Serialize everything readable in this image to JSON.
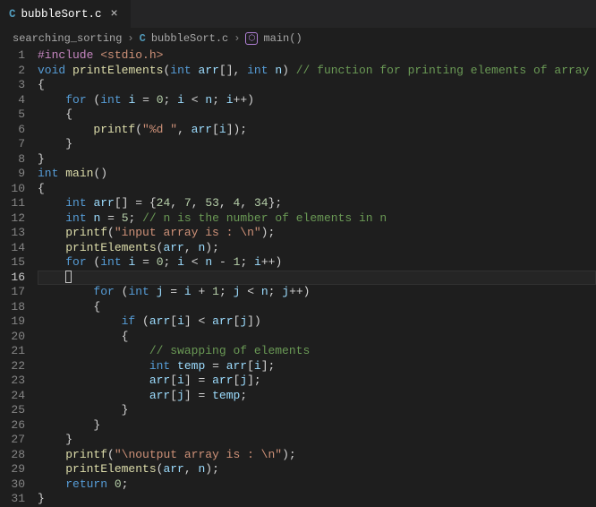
{
  "tab": {
    "icon_letter": "C",
    "filename": "bubbleSort.c",
    "close_glyph": "×"
  },
  "breadcrumb": {
    "folder": "searching_sorting",
    "chev": "›",
    "file_icon": "C",
    "filename": "bubbleSort.c",
    "symbol_icon": "⬡",
    "symbol": "main()"
  },
  "current_line": 16,
  "lines": [
    {
      "n": 1,
      "tokens": [
        [
          "pp",
          "#include"
        ],
        [
          "punc",
          " "
        ],
        [
          "inc",
          "<stdio.h>"
        ]
      ]
    },
    {
      "n": 2,
      "tokens": [
        [
          "type",
          "void"
        ],
        [
          "punc",
          " "
        ],
        [
          "fn",
          "printElements"
        ],
        [
          "punc",
          "("
        ],
        [
          "type",
          "int"
        ],
        [
          "punc",
          " "
        ],
        [
          "param",
          "arr"
        ],
        [
          "punc",
          "[], "
        ],
        [
          "type",
          "int"
        ],
        [
          "punc",
          " "
        ],
        [
          "param",
          "n"
        ],
        [
          "punc",
          ") "
        ],
        [
          "cmt",
          "// function for printing elements of array"
        ]
      ]
    },
    {
      "n": 3,
      "tokens": [
        [
          "punc",
          "{"
        ]
      ]
    },
    {
      "n": 4,
      "tokens": [
        [
          "punc",
          "    "
        ],
        [
          "kw",
          "for"
        ],
        [
          "punc",
          " ("
        ],
        [
          "type",
          "int"
        ],
        [
          "punc",
          " "
        ],
        [
          "var",
          "i"
        ],
        [
          "punc",
          " "
        ],
        [
          "op",
          "="
        ],
        [
          "punc",
          " "
        ],
        [
          "num",
          "0"
        ],
        [
          "punc",
          "; "
        ],
        [
          "var",
          "i"
        ],
        [
          "punc",
          " "
        ],
        [
          "op",
          "<"
        ],
        [
          "punc",
          " "
        ],
        [
          "var",
          "n"
        ],
        [
          "punc",
          "; "
        ],
        [
          "var",
          "i"
        ],
        [
          "op",
          "++"
        ],
        [
          "punc",
          ")"
        ]
      ]
    },
    {
      "n": 5,
      "tokens": [
        [
          "punc",
          "    {"
        ]
      ]
    },
    {
      "n": 6,
      "tokens": [
        [
          "punc",
          "        "
        ],
        [
          "fn",
          "printf"
        ],
        [
          "punc",
          "("
        ],
        [
          "str",
          "\"%d \""
        ],
        [
          "punc",
          ", "
        ],
        [
          "var",
          "arr"
        ],
        [
          "punc",
          "["
        ],
        [
          "var",
          "i"
        ],
        [
          "punc",
          "]);"
        ]
      ]
    },
    {
      "n": 7,
      "tokens": [
        [
          "punc",
          "    }"
        ]
      ]
    },
    {
      "n": 8,
      "tokens": [
        [
          "punc",
          "}"
        ]
      ]
    },
    {
      "n": 9,
      "tokens": [
        [
          "type",
          "int"
        ],
        [
          "punc",
          " "
        ],
        [
          "fn",
          "main"
        ],
        [
          "punc",
          "()"
        ]
      ]
    },
    {
      "n": 10,
      "tokens": [
        [
          "punc",
          "{"
        ]
      ]
    },
    {
      "n": 11,
      "tokens": [
        [
          "punc",
          "    "
        ],
        [
          "type",
          "int"
        ],
        [
          "punc",
          " "
        ],
        [
          "var",
          "arr"
        ],
        [
          "punc",
          "[] "
        ],
        [
          "op",
          "="
        ],
        [
          "punc",
          " {"
        ],
        [
          "num",
          "24"
        ],
        [
          "punc",
          ", "
        ],
        [
          "num",
          "7"
        ],
        [
          "punc",
          ", "
        ],
        [
          "num",
          "53"
        ],
        [
          "punc",
          ", "
        ],
        [
          "num",
          "4"
        ],
        [
          "punc",
          ", "
        ],
        [
          "num",
          "34"
        ],
        [
          "punc",
          "};"
        ]
      ]
    },
    {
      "n": 12,
      "tokens": [
        [
          "punc",
          "    "
        ],
        [
          "type",
          "int"
        ],
        [
          "punc",
          " "
        ],
        [
          "var",
          "n"
        ],
        [
          "punc",
          " "
        ],
        [
          "op",
          "="
        ],
        [
          "punc",
          " "
        ],
        [
          "num",
          "5"
        ],
        [
          "punc",
          "; "
        ],
        [
          "cmt",
          "// n is the number of elements in n"
        ]
      ]
    },
    {
      "n": 13,
      "tokens": [
        [
          "punc",
          "    "
        ],
        [
          "fn",
          "printf"
        ],
        [
          "punc",
          "("
        ],
        [
          "str",
          "\"input array is : \\n\""
        ],
        [
          "punc",
          ");"
        ]
      ]
    },
    {
      "n": 14,
      "tokens": [
        [
          "punc",
          "    "
        ],
        [
          "fn",
          "printElements"
        ],
        [
          "punc",
          "("
        ],
        [
          "var",
          "arr"
        ],
        [
          "punc",
          ", "
        ],
        [
          "var",
          "n"
        ],
        [
          "punc",
          ");"
        ]
      ]
    },
    {
      "n": 15,
      "tokens": [
        [
          "punc",
          "    "
        ],
        [
          "kw",
          "for"
        ],
        [
          "punc",
          " ("
        ],
        [
          "type",
          "int"
        ],
        [
          "punc",
          " "
        ],
        [
          "var",
          "i"
        ],
        [
          "punc",
          " "
        ],
        [
          "op",
          "="
        ],
        [
          "punc",
          " "
        ],
        [
          "num",
          "0"
        ],
        [
          "punc",
          "; "
        ],
        [
          "var",
          "i"
        ],
        [
          "punc",
          " "
        ],
        [
          "op",
          "<"
        ],
        [
          "punc",
          " "
        ],
        [
          "var",
          "n"
        ],
        [
          "punc",
          " "
        ],
        [
          "op",
          "-"
        ],
        [
          "punc",
          " "
        ],
        [
          "num",
          "1"
        ],
        [
          "punc",
          "; "
        ],
        [
          "var",
          "i"
        ],
        [
          "op",
          "++"
        ],
        [
          "punc",
          ")"
        ]
      ]
    },
    {
      "n": 16,
      "tokens": [
        [
          "punc",
          "    "
        ],
        [
          "cursor",
          ""
        ]
      ]
    },
    {
      "n": 17,
      "tokens": [
        [
          "punc",
          "        "
        ],
        [
          "kw",
          "for"
        ],
        [
          "punc",
          " ("
        ],
        [
          "type",
          "int"
        ],
        [
          "punc",
          " "
        ],
        [
          "var",
          "j"
        ],
        [
          "punc",
          " "
        ],
        [
          "op",
          "="
        ],
        [
          "punc",
          " "
        ],
        [
          "var",
          "i"
        ],
        [
          "punc",
          " "
        ],
        [
          "op",
          "+"
        ],
        [
          "punc",
          " "
        ],
        [
          "num",
          "1"
        ],
        [
          "punc",
          "; "
        ],
        [
          "var",
          "j"
        ],
        [
          "punc",
          " "
        ],
        [
          "op",
          "<"
        ],
        [
          "punc",
          " "
        ],
        [
          "var",
          "n"
        ],
        [
          "punc",
          "; "
        ],
        [
          "var",
          "j"
        ],
        [
          "op",
          "++"
        ],
        [
          "punc",
          ")"
        ]
      ]
    },
    {
      "n": 18,
      "tokens": [
        [
          "punc",
          "        {"
        ]
      ]
    },
    {
      "n": 19,
      "tokens": [
        [
          "punc",
          "            "
        ],
        [
          "kw",
          "if"
        ],
        [
          "punc",
          " ("
        ],
        [
          "var",
          "arr"
        ],
        [
          "punc",
          "["
        ],
        [
          "var",
          "i"
        ],
        [
          "punc",
          "] "
        ],
        [
          "op",
          "<"
        ],
        [
          "punc",
          " "
        ],
        [
          "var",
          "arr"
        ],
        [
          "punc",
          "["
        ],
        [
          "var",
          "j"
        ],
        [
          "punc",
          "])"
        ]
      ]
    },
    {
      "n": 20,
      "tokens": [
        [
          "punc",
          "            {"
        ]
      ]
    },
    {
      "n": 21,
      "tokens": [
        [
          "punc",
          "                "
        ],
        [
          "cmt",
          "// swapping of elements"
        ]
      ]
    },
    {
      "n": 22,
      "tokens": [
        [
          "punc",
          "                "
        ],
        [
          "type",
          "int"
        ],
        [
          "punc",
          " "
        ],
        [
          "var",
          "temp"
        ],
        [
          "punc",
          " "
        ],
        [
          "op",
          "="
        ],
        [
          "punc",
          " "
        ],
        [
          "var",
          "arr"
        ],
        [
          "punc",
          "["
        ],
        [
          "var",
          "i"
        ],
        [
          "punc",
          "];"
        ]
      ]
    },
    {
      "n": 23,
      "tokens": [
        [
          "punc",
          "                "
        ],
        [
          "var",
          "arr"
        ],
        [
          "punc",
          "["
        ],
        [
          "var",
          "i"
        ],
        [
          "punc",
          "] "
        ],
        [
          "op",
          "="
        ],
        [
          "punc",
          " "
        ],
        [
          "var",
          "arr"
        ],
        [
          "punc",
          "["
        ],
        [
          "var",
          "j"
        ],
        [
          "punc",
          "];"
        ]
      ]
    },
    {
      "n": 24,
      "tokens": [
        [
          "punc",
          "                "
        ],
        [
          "var",
          "arr"
        ],
        [
          "punc",
          "["
        ],
        [
          "var",
          "j"
        ],
        [
          "punc",
          "] "
        ],
        [
          "op",
          "="
        ],
        [
          "punc",
          " "
        ],
        [
          "var",
          "temp"
        ],
        [
          "punc",
          ";"
        ]
      ]
    },
    {
      "n": 25,
      "tokens": [
        [
          "punc",
          "            }"
        ]
      ]
    },
    {
      "n": 26,
      "tokens": [
        [
          "punc",
          "        }"
        ]
      ]
    },
    {
      "n": 27,
      "tokens": [
        [
          "punc",
          "    }"
        ]
      ]
    },
    {
      "n": 28,
      "tokens": [
        [
          "punc",
          "    "
        ],
        [
          "fn",
          "printf"
        ],
        [
          "punc",
          "("
        ],
        [
          "str",
          "\"\\noutput array is : \\n\""
        ],
        [
          "punc",
          ");"
        ]
      ]
    },
    {
      "n": 29,
      "tokens": [
        [
          "punc",
          "    "
        ],
        [
          "fn",
          "printElements"
        ],
        [
          "punc",
          "("
        ],
        [
          "var",
          "arr"
        ],
        [
          "punc",
          ", "
        ],
        [
          "var",
          "n"
        ],
        [
          "punc",
          ");"
        ]
      ]
    },
    {
      "n": 30,
      "tokens": [
        [
          "punc",
          "    "
        ],
        [
          "kw",
          "return"
        ],
        [
          "punc",
          " "
        ],
        [
          "num",
          "0"
        ],
        [
          "punc",
          ";"
        ]
      ]
    },
    {
      "n": 31,
      "tokens": [
        [
          "punc",
          "}"
        ]
      ]
    }
  ]
}
